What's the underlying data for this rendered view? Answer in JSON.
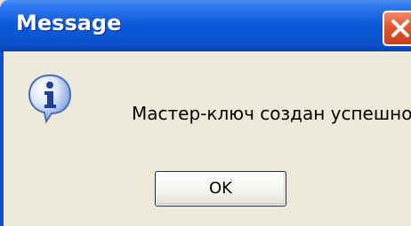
{
  "dialog": {
    "title": "Message",
    "message": "Мастер-ключ создан успешно!",
    "ok_label": "OK",
    "icon": "info-icon",
    "close_icon": "close-icon"
  },
  "colors": {
    "titlebar": "#0a56d4",
    "body": "#ece9d8",
    "close_button": "#e0562c",
    "text": "#000000"
  }
}
